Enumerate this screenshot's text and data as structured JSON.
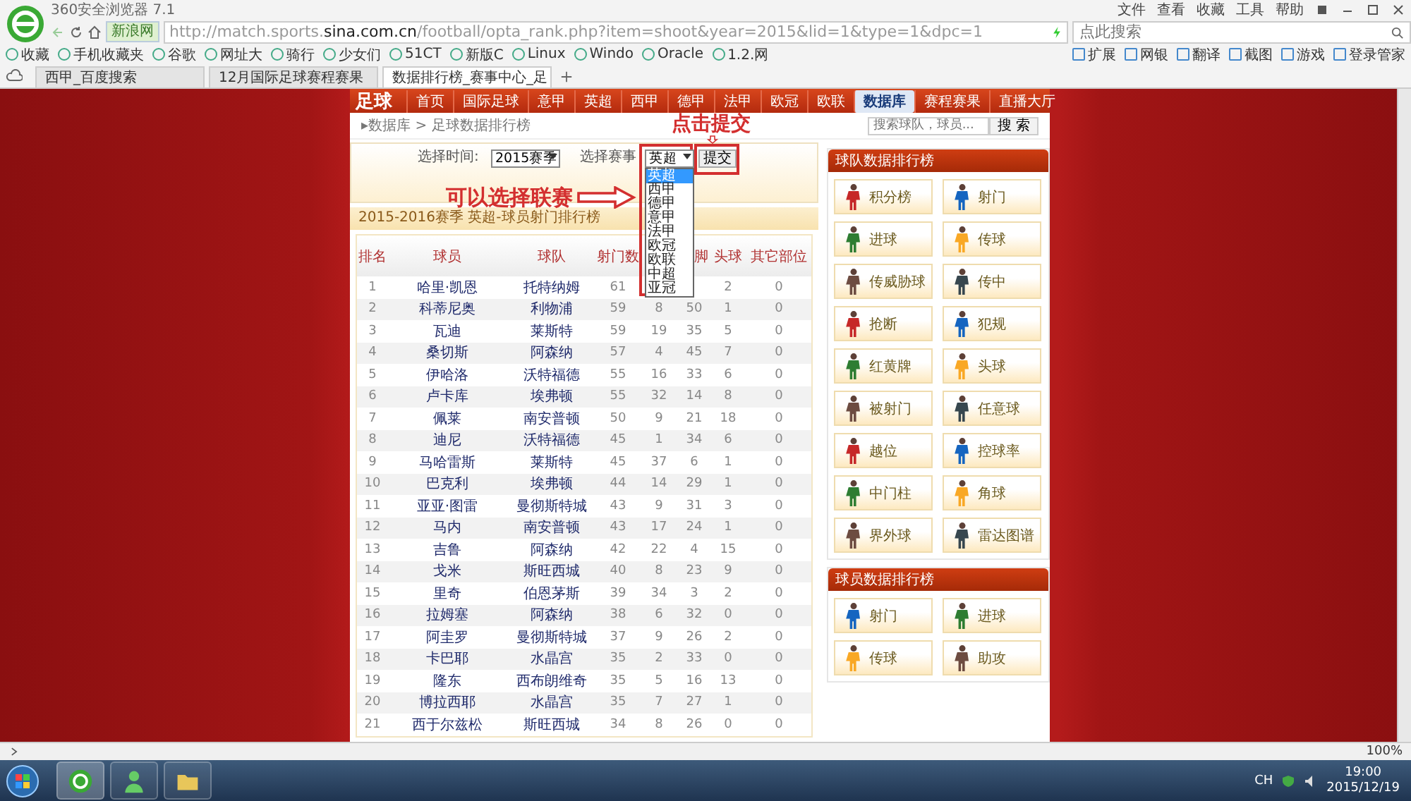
{
  "browser": {
    "title": "360安全浏览器 7.1",
    "menu": [
      "文件",
      "查看",
      "收藏",
      "工具",
      "帮助"
    ],
    "site_badge": "新浪网",
    "url": "http://match.sports.**sina.com.cn**/football/opta_rank.php?item=shoot&year=2015&lid=1&type=1&dpc=1",
    "search": {
      "placeholder": "点此搜索"
    },
    "bookmarks": [
      "收藏",
      "手机收藏夹",
      "谷歌",
      "网址大",
      "骑行",
      "少女们",
      "51CT",
      "新版C",
      "Linux",
      "Windo",
      "Oracle",
      "1.2.网"
    ],
    "tools": [
      "扩展",
      "网银",
      "翻译",
      "截图",
      "游戏",
      "登录管家"
    ],
    "tabs": [
      {
        "label": "西甲_百度搜索",
        "selected": false
      },
      {
        "label": "12月国际足球赛程赛果",
        "selected": false
      },
      {
        "label": "数据排行榜_赛事中心_足",
        "selected": true
      }
    ]
  },
  "site": {
    "logo": "足球",
    "nav": [
      {
        "label": "首页",
        "selected": false
      },
      {
        "label": "国际足球",
        "selected": false
      },
      {
        "label": "意甲",
        "selected": false
      },
      {
        "label": "英超",
        "selected": false
      },
      {
        "label": "西甲",
        "selected": false
      },
      {
        "label": "德甲",
        "selected": false
      },
      {
        "label": "法甲",
        "selected": false
      },
      {
        "label": "欧冠",
        "selected": false
      },
      {
        "label": "欧联",
        "selected": false
      },
      {
        "label": "数据库",
        "selected": true
      },
      {
        "label": "赛程赛果",
        "selected": false
      },
      {
        "label": "直播大厅",
        "selected": false
      }
    ],
    "breadcrumb": "▸数据库 > 足球数据排行榜",
    "search": {
      "placeholder": "搜索球队，球员...",
      "button": "搜 索"
    }
  },
  "filter": {
    "time_label": "选择时间:",
    "time_value": "2015赛季",
    "league_label": "选择赛事",
    "league_value": "英超",
    "submit": "提交",
    "options": [
      {
        "label": "英超",
        "selected": true
      },
      {
        "label": "西甲",
        "selected": false
      },
      {
        "label": "德甲",
        "selected": false
      },
      {
        "label": "意甲",
        "selected": false
      },
      {
        "label": "法甲",
        "selected": false
      },
      {
        "label": "欧冠",
        "selected": false
      },
      {
        "label": "欧联",
        "selected": false
      },
      {
        "label": "中超",
        "selected": false
      },
      {
        "label": "亚冠",
        "selected": false
      }
    ]
  },
  "annotations": {
    "submit_hint": "点击提交",
    "league_hint": "可以选择联赛"
  },
  "table": {
    "title": "2015-2016赛季 英超-球员射门排行榜",
    "columns": [
      "排名",
      "球员",
      "球队",
      "射门数",
      null,
      "脚",
      "头球",
      "其它部位"
    ],
    "rows": [
      [
        "1",
        "哈里·凯恩",
        "托特纳姆",
        "61",
        null,
        null,
        "2",
        "0"
      ],
      [
        "2",
        "科蒂尼奥",
        "利物浦",
        "59",
        "8",
        "50",
        "1",
        "0"
      ],
      [
        "3",
        "瓦迪",
        "莱斯特",
        "59",
        "19",
        "35",
        "5",
        "0"
      ],
      [
        "4",
        "桑切斯",
        "阿森纳",
        "57",
        "4",
        "45",
        "7",
        "0"
      ],
      [
        "5",
        "伊哈洛",
        "沃特福德",
        "55",
        "16",
        "33",
        "6",
        "0"
      ],
      [
        "6",
        "卢卡库",
        "埃弗顿",
        "55",
        "32",
        "14",
        "8",
        "0"
      ],
      [
        "7",
        "佩莱",
        "南安普顿",
        "50",
        "9",
        "21",
        "18",
        "0"
      ],
      [
        "8",
        "迪尼",
        "沃特福德",
        "45",
        "1",
        "34",
        "6",
        "0"
      ],
      [
        "9",
        "马哈雷斯",
        "莱斯特",
        "45",
        "37",
        "6",
        "1",
        "0"
      ],
      [
        "10",
        "巴克利",
        "埃弗顿",
        "44",
        "14",
        "29",
        "1",
        "0"
      ],
      [
        "11",
        "亚亚·图雷",
        "曼彻斯特城",
        "43",
        "9",
        "31",
        "3",
        "0"
      ],
      [
        "12",
        "马内",
        "南安普顿",
        "43",
        "17",
        "24",
        "1",
        "0"
      ],
      [
        "13",
        "吉鲁",
        "阿森纳",
        "42",
        "22",
        "4",
        "15",
        "0"
      ],
      [
        "14",
        "戈米",
        "斯旺西城",
        "40",
        "8",
        "23",
        "9",
        "0"
      ],
      [
        "15",
        "里奇",
        "伯恩茅斯",
        "39",
        "34",
        "3",
        "2",
        "0"
      ],
      [
        "16",
        "拉姆塞",
        "阿森纳",
        "38",
        "6",
        "32",
        "0",
        "0"
      ],
      [
        "17",
        "阿圭罗",
        "曼彻斯特城",
        "37",
        "9",
        "26",
        "2",
        "0"
      ],
      [
        "18",
        "卡巴耶",
        "水晶宫",
        "35",
        "2",
        "33",
        "0",
        "0"
      ],
      [
        "19",
        "隆东",
        "西布朗维奇",
        "35",
        "5",
        "16",
        "13",
        "0"
      ],
      [
        "20",
        "博拉西耶",
        "水晶宫",
        "35",
        "7",
        "27",
        "1",
        "0"
      ],
      [
        "21",
        "西于尔兹松",
        "斯旺西城",
        "34",
        "8",
        "26",
        "0",
        "0"
      ]
    ]
  },
  "sidebar": [
    {
      "title": "球队数据排行榜",
      "items": [
        "积分榜",
        "射门",
        "进球",
        "传球",
        "传威胁球",
        "传中",
        "抢断",
        "犯规",
        "红黄牌",
        "头球",
        "被射门",
        "任意球",
        "越位",
        "控球率",
        "中门柱",
        "角球",
        "界外球",
        "雷达图谱"
      ]
    },
    {
      "title": "球员数据排行榜",
      "items": [
        "射门",
        "进球",
        "传球",
        "助攻"
      ]
    }
  ],
  "status_bar": {
    "zoom": "100%"
  },
  "taskbar": {
    "language": "CH",
    "time": "19:00",
    "date": "2015/12/19"
  }
}
